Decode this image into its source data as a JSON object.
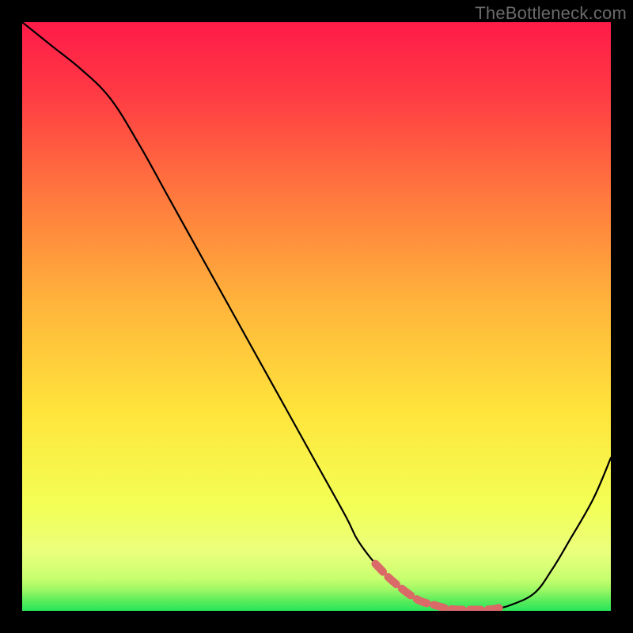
{
  "watermark": "TheBottleneck.com",
  "colors": {
    "bg_top": "#ff1b49",
    "bg_mid1": "#ffb13b",
    "bg_mid2": "#ffe43b",
    "bg_mid3": "#f7ff6a",
    "bg_bottom": "#28e65a",
    "curve": "#000000",
    "highlight": "#da6a67",
    "frame": "#000000"
  },
  "chart_data": {
    "type": "line",
    "title": "",
    "xlabel": "",
    "ylabel": "",
    "xlim": [
      0,
      100
    ],
    "ylim": [
      0,
      100
    ],
    "x": [
      0,
      5,
      10,
      15,
      20,
      25,
      30,
      35,
      40,
      45,
      50,
      55,
      57,
      60,
      63,
      67,
      70,
      73,
      77,
      80,
      83,
      87,
      90,
      93,
      97,
      100
    ],
    "values": [
      100,
      96,
      92,
      87,
      79,
      70,
      61,
      52,
      43,
      34,
      25,
      16,
      12,
      8,
      5,
      2,
      1,
      0.3,
      0.2,
      0.3,
      1,
      3,
      7,
      12,
      19,
      26
    ],
    "highlight_x_range": [
      60,
      82
    ],
    "annotations": []
  }
}
